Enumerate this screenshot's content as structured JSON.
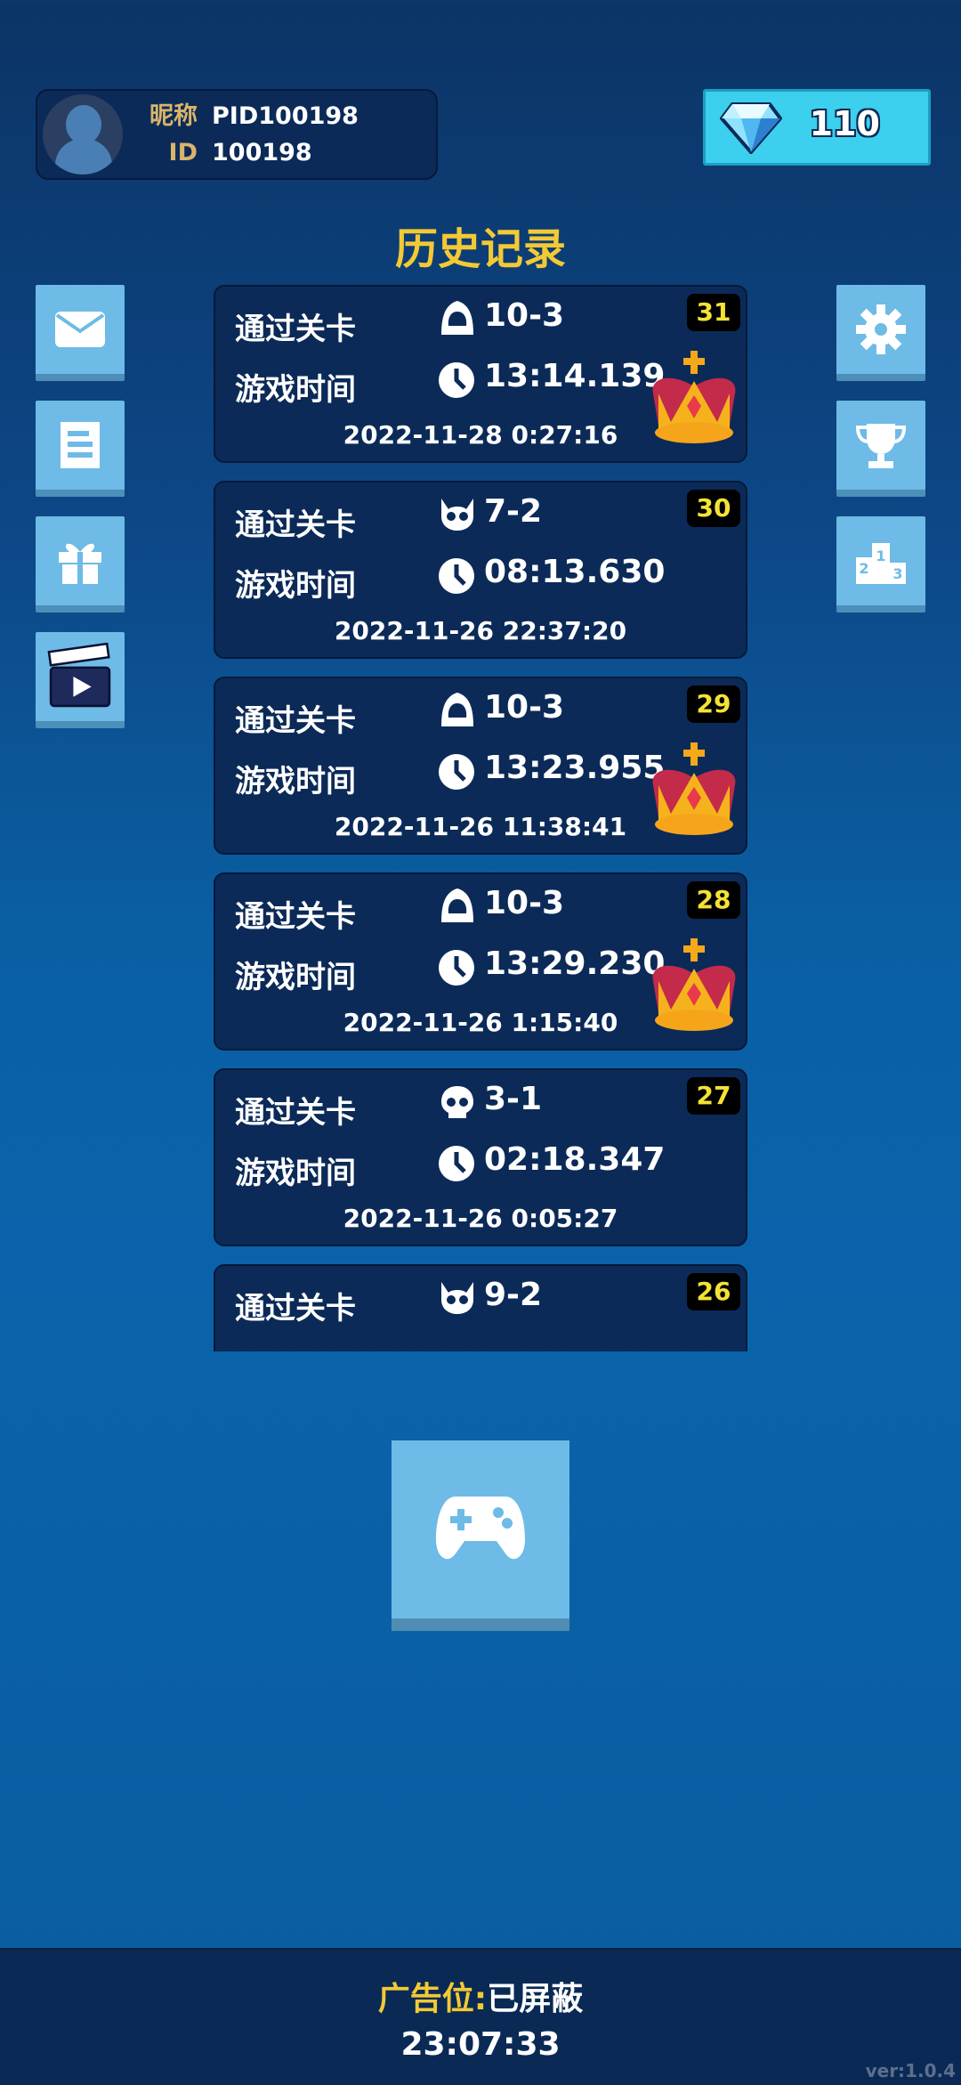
{
  "profile": {
    "nickname_label": "昵称",
    "nickname": "PID100198",
    "id_label": "ID",
    "id": "100198"
  },
  "gems": {
    "count": "110",
    "icon": "diamond-icon"
  },
  "title": "历史记录",
  "left_menu": [
    {
      "name": "mail",
      "icon": "envelope-icon"
    },
    {
      "name": "notes",
      "icon": "document-icon"
    },
    {
      "name": "gift",
      "icon": "gift-icon"
    },
    {
      "name": "video",
      "icon": "clapperboard-icon"
    }
  ],
  "right_menu": [
    {
      "name": "settings",
      "icon": "gear-icon"
    },
    {
      "name": "trophy",
      "icon": "trophy-icon"
    },
    {
      "name": "leaderboard",
      "icon": "podium-icon"
    }
  ],
  "records": [
    {
      "rank": "31",
      "level_label": "通过关卡",
      "level_icon": "hooded-icon",
      "level": "10-3",
      "time_label": "游戏时间",
      "time": "13:14.139",
      "date": "2022-11-28  0:27:16",
      "crown": true
    },
    {
      "rank": "30",
      "level_label": "通过关卡",
      "level_icon": "demon-skull-icon",
      "level": "7-2",
      "time_label": "游戏时间",
      "time": "08:13.630",
      "date": "2022-11-26  22:37:20",
      "crown": false
    },
    {
      "rank": "29",
      "level_label": "通过关卡",
      "level_icon": "hooded-icon",
      "level": "10-3",
      "time_label": "游戏时间",
      "time": "13:23.955",
      "date": "2022-11-26  11:38:41",
      "crown": true
    },
    {
      "rank": "28",
      "level_label": "通过关卡",
      "level_icon": "hooded-icon",
      "level": "10-3",
      "time_label": "游戏时间",
      "time": "13:29.230",
      "date": "2022-11-26  1:15:40",
      "crown": true
    },
    {
      "rank": "27",
      "level_label": "通过关卡",
      "level_icon": "skull-icon",
      "level": "3-1",
      "time_label": "游戏时间",
      "time": "02:18.347",
      "date": "2022-11-26  0:05:27",
      "crown": false
    },
    {
      "rank": "26",
      "level_label": "通过关卡",
      "level_icon": "demon-skull-icon",
      "level": "9-2",
      "time_label": "游戏时间",
      "time": "",
      "date": "",
      "crown": false
    }
  ],
  "footer": {
    "ad_label": "广告位:",
    "ad_value": "已屏蔽",
    "clock": "23:07:33",
    "version": "ver:1.0.4"
  }
}
